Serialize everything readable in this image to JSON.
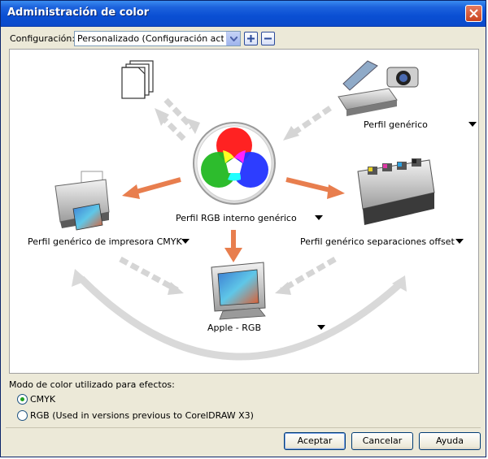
{
  "window": {
    "title": "Administración de color"
  },
  "config": {
    "label": "Configuración:",
    "selected": "Personalizado (Configuración act..."
  },
  "diagram": {
    "generic_profile": "Perfil genérico",
    "rgb_profile": "Perfil RGB interno genérico",
    "printer_profile": "Perfil genérico de impresora CMYK",
    "offset_profile": "Perfil genérico separaciones offset",
    "monitor_profile": "Apple - RGB"
  },
  "color_mode": {
    "label": "Modo de color utilizado para efectos:",
    "options": [
      {
        "label": "CMYK",
        "selected": true
      },
      {
        "label": "RGB (Used in versions previous to CorelDRAW X3)",
        "selected": false
      }
    ]
  },
  "buttons": {
    "ok": "Aceptar",
    "cancel": "Cancelar",
    "help": "Ayuda"
  },
  "colors": {
    "accent_arrow": "#e87e4e",
    "titlebar": "#0a4fd3",
    "close": "#d9572f"
  }
}
